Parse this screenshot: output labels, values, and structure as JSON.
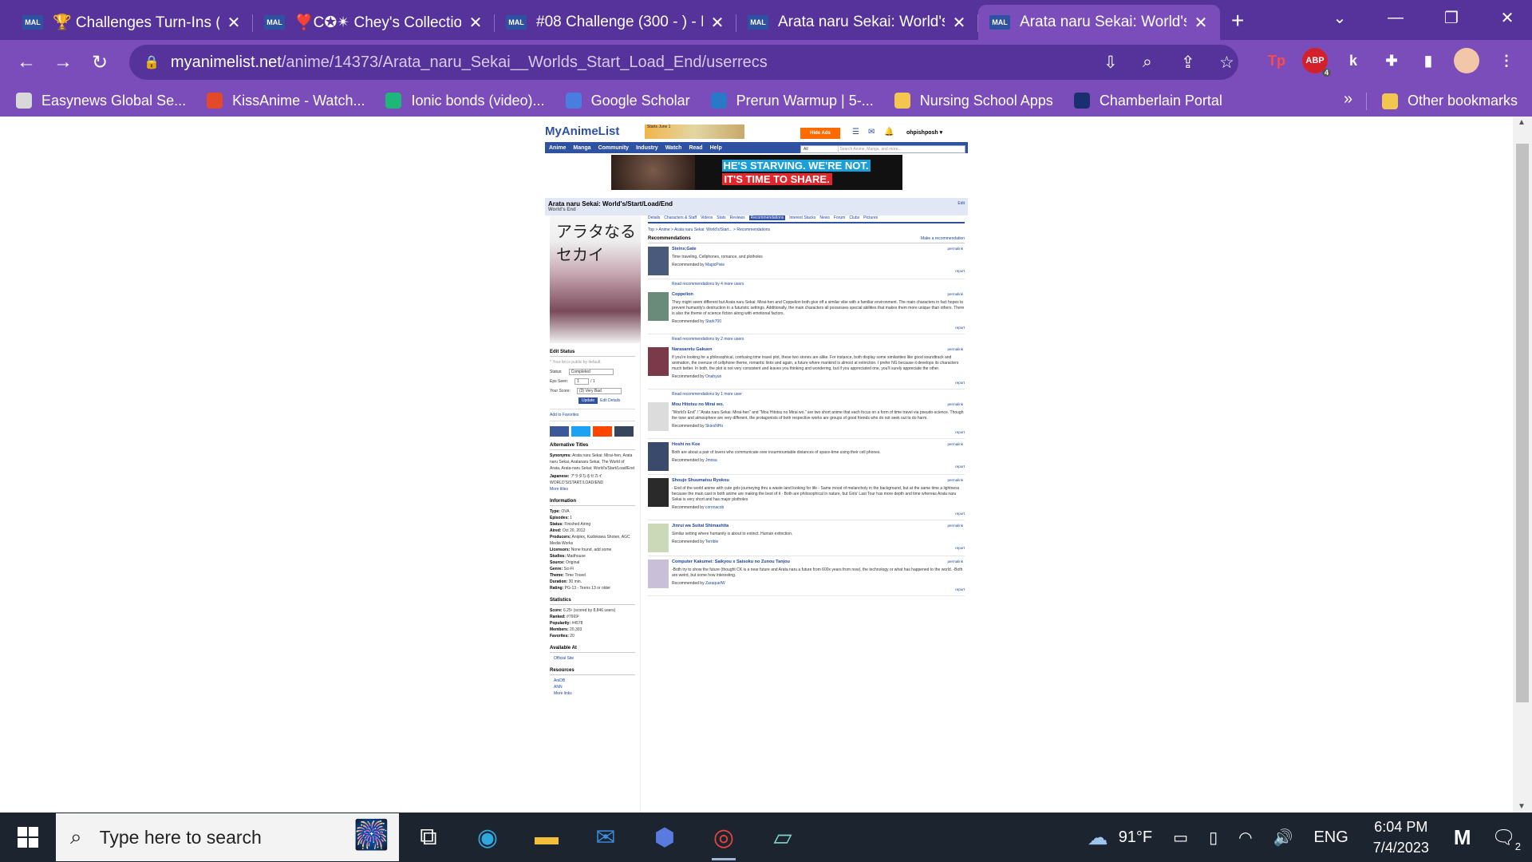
{
  "browser": {
    "tabs": [
      {
        "favicon": "MAL",
        "title": "🏆 Challenges Turn-Ins (v",
        "active": false
      },
      {
        "favicon": "MAL",
        "title": "❣️C✪✴ Chey's Collection",
        "active": false
      },
      {
        "favicon": "MAL",
        "title": "#08 Challenge (300 - ) - F",
        "active": false
      },
      {
        "favicon": "MAL",
        "title": "Arata naru Sekai: World's/",
        "active": false
      },
      {
        "favicon": "MAL",
        "title": "Arata naru Sekai: World's/",
        "active": true
      }
    ],
    "new_tab": "+",
    "url_host": "myanimelist.net",
    "url_path": "/anime/14373/Arata_naru_Sekai__Worlds_Start_Load_End/userrecs",
    "abp_badge": "4",
    "bookmarks": [
      {
        "label": "Easynews Global Se...",
        "color": "#d8d8d8"
      },
      {
        "label": "KissAnime - Watch...",
        "color": "#e24a2a"
      },
      {
        "label": "Ionic bonds (video)...",
        "color": "#1fb67a"
      },
      {
        "label": "Google Scholar",
        "color": "#4a7de0"
      },
      {
        "label": "Prerun Warmup | 5-...",
        "color": "#2a78c8"
      },
      {
        "label": "Nursing School Apps",
        "color": "#f3c74f"
      },
      {
        "label": "Chamberlain Portal",
        "color": "#1a2f6d"
      }
    ],
    "bookmarks_overflow": "»",
    "other_bookmarks": "Other bookmarks"
  },
  "mal": {
    "logo": "MyAnimeList",
    "promo": "Starts June 1",
    "hide_ads": "Hide Ads",
    "username": "ohpishposh ▾",
    "nav": [
      "Anime",
      "Manga",
      "Community",
      "Industry",
      "Watch",
      "Read",
      "Help"
    ],
    "search_scope": "All",
    "search_placeholder": "Search Anime, Manga, and more...",
    "ad_line1": "HE'S STARVING. WE'RE NOT.",
    "ad_line2": "IT'S TIME TO SHARE.",
    "title": "Arata naru Sekai: World's/Start/Load/End",
    "subtitle": "World's End",
    "edit": "Edit",
    "cover_text": "アラタなるセカイ",
    "edit_status": {
      "heading": "Edit Status",
      "note": "* Your list is public by default.",
      "status_label": "Status:",
      "status_value": "Completed",
      "eps_label": "Eps Seen:",
      "eps_value": "1",
      "eps_total": "/ 1",
      "score_label": "Your Score:",
      "score_value": "(3) Very Bad",
      "update": "Update",
      "edit_details": "Edit Details"
    },
    "add_fav": "Add to Favorites",
    "alt_titles": {
      "heading": "Alternative Titles",
      "synonyms_label": "Synonyms:",
      "synonyms": "Arata naru Sekai: Mirai-hen, Arata naru Sekai, Aratanaru Sekai, The World of Arata, Arata-naru Sekai: World's/Start/Load/End",
      "japanese_label": "Japanese:",
      "japanese": "アラタなるセカイ WORLD'S/START/LOAD/END",
      "more": "More titles"
    },
    "information": {
      "heading": "Information",
      "rows": [
        {
          "k": "Type:",
          "v": "OVA"
        },
        {
          "k": "Episodes:",
          "v": "1"
        },
        {
          "k": "Status:",
          "v": "Finished Airing"
        },
        {
          "k": "Aired:",
          "v": "Oct 20, 2012"
        },
        {
          "k": "Producers:",
          "v": "Aniplex, Kadokawa Shoten, AGC Media Works"
        },
        {
          "k": "Licensors:",
          "v": "None found, add some"
        },
        {
          "k": "Studios:",
          "v": "Madhouse"
        },
        {
          "k": "Source:",
          "v": "Original"
        },
        {
          "k": "Genre:",
          "v": "Sci-Fi"
        },
        {
          "k": "Theme:",
          "v": "Time Travel"
        },
        {
          "k": "Duration:",
          "v": "30 min."
        },
        {
          "k": "Rating:",
          "v": "PG-13 - Teens 13 or older"
        }
      ]
    },
    "statistics": {
      "heading": "Statistics",
      "rows": [
        {
          "k": "Score:",
          "v": "6.25¹ (scored by 8,846 users)"
        },
        {
          "k": "Ranked:",
          "v": "#7669²"
        },
        {
          "k": "Popularity:",
          "v": "#4578"
        },
        {
          "k": "Members:",
          "v": "20,303"
        },
        {
          "k": "Favorites:",
          "v": "20"
        }
      ]
    },
    "available_at": {
      "heading": "Available At",
      "item": "Official Site"
    },
    "resources": {
      "heading": "Resources",
      "items": [
        "AniDB",
        "ANN"
      ],
      "more": "More links"
    },
    "page_tabs": [
      "Details",
      "Characters & Staff",
      "Videos",
      "Stats",
      "Reviews",
      "Recommendations",
      "Interest Stacks",
      "News",
      "Forum",
      "Clubs",
      "Pictures"
    ],
    "active_tab": "Recommendations",
    "breadcrumb": "Top  >  Anime  >  Arata naru Sekai: World's/Start...  >  Recommendations",
    "rec_heading": "Recommendations",
    "make_rec": "Make a recommendation",
    "permalink": "permalink",
    "report": "report",
    "recs": [
      {
        "name": "Steins;Gate",
        "text": "Time traveling, Cellphones, romance, and plotholes",
        "by": "MagicPixie",
        "more": "Read recommendations by 4 more users",
        "color": "#4a5a7a"
      },
      {
        "name": "Coppelion",
        "text": "They might seem different but Arata naru Sekai: Mirai-hen and Coppelion both give off a similar vibe with a familiar environment. The main characters in fact hopes to prevent humanity's destruction in a futuristic settings. Additionally, the main characters all possesses special abilities that makes them more unique than others. There is also the theme of science fiction along with emotional factors.",
        "by": "Stark700",
        "more": "Read recommendations by 2 more users",
        "color": "#6a8a7a"
      },
      {
        "name": "Narasaretu Gakuen",
        "text": "If you're looking for a philosophical, confusing time travel plot, these two stories are alike. For instance, both display some similarities like good soundtrack and animation, the overuse of cellphone theme, romantic links and again, a future where mankind is almost at extinction. I prefer NG because it develops its characters much better. In both, the plot is not very consistent and leaves you thinking and wondering, but if you appreciated one, you'll surely appreciate the other.",
        "by": "Onahyun",
        "more": "Read recommendations by 1 more user",
        "color": "#7a3a4a"
      },
      {
        "name": "Mou Hitotsu no Mirai wo.",
        "text": "\"World's End\" / \"Arata naru Sekai: Mirai-hen\" and \"Mou Hitotsu no Mirai wo.\" are two short anime that each focus on a form of time travel via pseudo-science. Though the tone and atmosphere are very different, the protagonists of both respective works are groups of good friends who do not seek out to do harm.",
        "by": "SkiesNHo",
        "more": "",
        "color": "#dcdcdc"
      },
      {
        "name": "Hoshi no Koe",
        "text": "Both are about a pair of lovers who communicate over insurmountable distances of space-time using their cell phones.",
        "by": "Jmosa",
        "more": "",
        "color": "#3a4a6a"
      },
      {
        "name": "Shoujo Shuumatsu Ryokou",
        "text": "- End of the world anime with cute girls journeying thru a waste land looking for life - Same mood of melancholy in the background, but at the same time a lightness because the main cast in both anime are making the best of it - Both are philosophical in nature, but Girls' Last Tour has more depth and time whereas Arata naru Sekai is very short and has major plotholes",
        "by": "coronacob",
        "more": "",
        "color": "#2a2a2a"
      },
      {
        "name": "Jinrui wa Suitai Shimashita",
        "text": "Similar setting where humanity is about to extinct. Human extinction.",
        "by": "Terrible",
        "more": "",
        "color": "#cbd9b8"
      },
      {
        "name": "Computer Kakumei: Saikyou x Saisoku no Zunou Tanjou",
        "text": "-Both try to show the future (thought CK is a near future and Arata naru a future from 600x years from now), the technology or what has happened to the world. -Both are weird, but some how interesting.",
        "by": "ZaraqueIW",
        "more": "",
        "color": "#c9c0d8"
      }
    ]
  },
  "taskbar": {
    "search_placeholder": "Type here to search",
    "weather": "91°F",
    "lang": "ENG",
    "time": "6:04 PM",
    "date": "7/4/2023",
    "notif_count": "2"
  }
}
